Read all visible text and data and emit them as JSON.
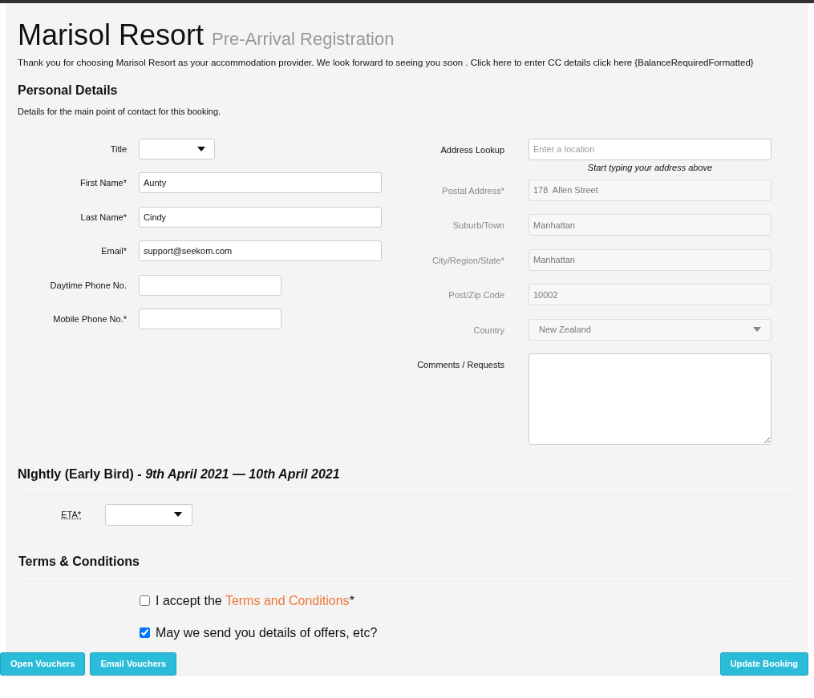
{
  "header": {
    "title": "Marisol Resort",
    "subtitle": "Pre-Arrival Registration",
    "intro": "Thank you for choosing Marisol Resort as your accommodation provider. We look forward to seeing you soon . Click here to enter CC details click here {BalanceRequiredFormatted}"
  },
  "personal": {
    "heading": "Personal Details",
    "description": "Details for the main point of contact for this booking.",
    "left_fields": [
      {
        "label": "Title",
        "kind": "select"
      },
      {
        "label": "First Name*",
        "kind": "text",
        "value": "Aunty"
      },
      {
        "label": "Last Name*",
        "kind": "text",
        "value": "Cindy"
      },
      {
        "label": "Email*",
        "kind": "text",
        "value": "support@seekom.com"
      },
      {
        "label": "Daytime Phone No.",
        "kind": "phone"
      },
      {
        "label": "Mobile Phone No.*",
        "kind": "phone"
      }
    ],
    "right_fields": [
      {
        "label": "Address Lookup",
        "kind": "text",
        "disabled": false,
        "placeholder": "Enter a location",
        "hint": "Start typing your address above"
      },
      {
        "label": "Postal Address*",
        "kind": "text",
        "disabled": true,
        "value": "178  Allen Street"
      },
      {
        "label": "Suburb/Town",
        "kind": "text",
        "disabled": true,
        "value": "Manhattan"
      },
      {
        "label": "City/Region/State*",
        "kind": "text",
        "disabled": true,
        "value": "Manhattan"
      },
      {
        "label": "Post/Zip Code",
        "kind": "text",
        "disabled": true,
        "value": "10002"
      },
      {
        "label": "Country",
        "kind": "select",
        "disabled": true,
        "value": "New Zealand"
      },
      {
        "label": "Comments / Requests",
        "kind": "textarea",
        "disabled": false
      }
    ]
  },
  "booking": {
    "heading": "NIghtly (Early Bird) *- 9th April 2021 — 10th April 2021*",
    "eta_label": "ETA*"
  },
  "terms": {
    "heading": "Terms & Conditions",
    "options": [
      {
        "text": "I accept the ",
        "link": "Terms and Conditions",
        "suffix": "*",
        "checked": false
      },
      {
        "text": "May we send you details of offers, etc?",
        "checked": true
      }
    ]
  },
  "buttons_left": [
    "Open Vouchers",
    "Email Vouchers"
  ],
  "buttons_right": [
    "Update Booking"
  ]
}
